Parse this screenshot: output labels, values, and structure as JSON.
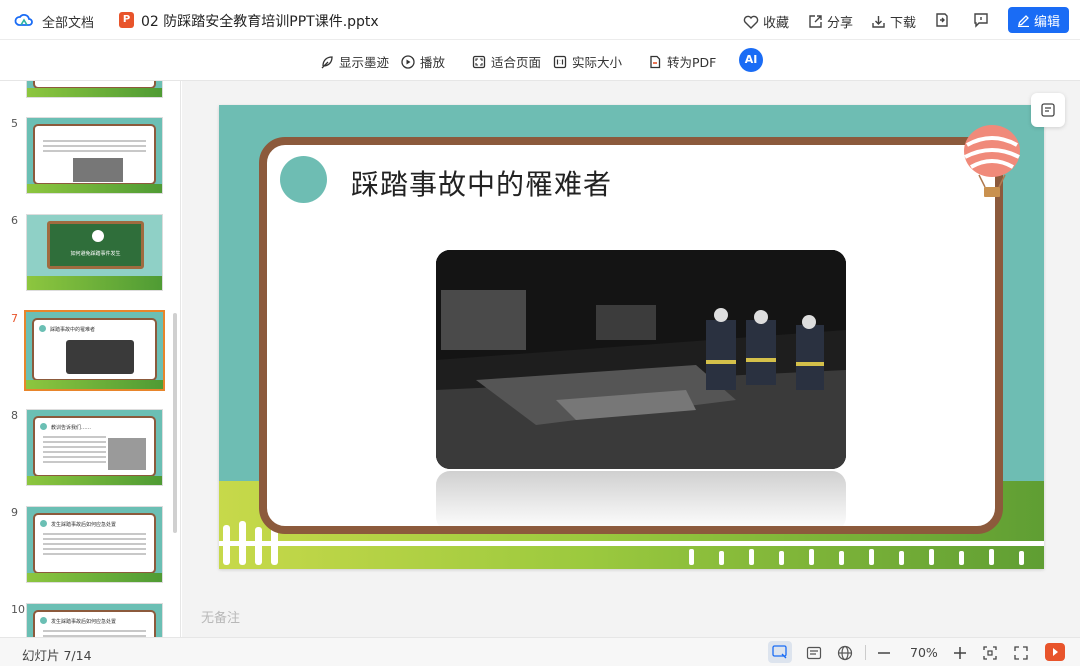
{
  "header": {
    "all_docs_label": "全部文档",
    "file_type_badge": "P",
    "file_name": "02 防踩踏安全教育培训PPT课件.pptx",
    "favorite_label": "收藏",
    "share_label": "分享",
    "download_label": "下载",
    "edit_label": "编辑"
  },
  "toolbar": {
    "show_ink_label": "显示墨迹",
    "play_label": "播放",
    "fit_page_label": "适合页面",
    "actual_size_label": "实际大小",
    "to_pdf_label": "转为PDF",
    "ai_label": "AI"
  },
  "thumbnails": [
    {
      "number": "5",
      "title": "",
      "active": false
    },
    {
      "number": "6",
      "title": "如何避免踩踏事件发生",
      "active": false
    },
    {
      "number": "7",
      "title": "踩踏事故中的罹难者",
      "active": true
    },
    {
      "number": "8",
      "title": "教训告诉我们……",
      "active": false
    },
    {
      "number": "9",
      "title": "发生踩踏事故后如何应急处置",
      "active": false
    },
    {
      "number": "10",
      "title": "发生踩踏事故后如何应急处置",
      "active": false
    }
  ],
  "slide": {
    "title": "踩踏事故中的罹难者"
  },
  "notes_placeholder": "无备注",
  "status": {
    "slide_count": "幻灯片 7/14",
    "zoom": "70%"
  },
  "colors": {
    "accent": "#1a6cf5",
    "ppt_badge": "#e8542b",
    "slide_bg": "#6ebdb3",
    "slide_border": "#8c5a3c",
    "active_thumb": "#e8852b"
  }
}
